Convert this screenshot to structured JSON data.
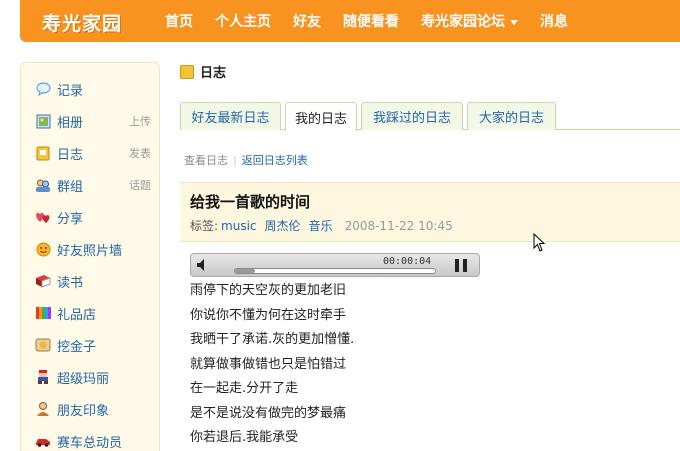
{
  "header": {
    "logo": "寿光家园",
    "nav": [
      {
        "label": "首页"
      },
      {
        "label": "个人主页"
      },
      {
        "label": "好友"
      },
      {
        "label": "随便看看"
      },
      {
        "label": "寿光家园论坛",
        "dropdown": true
      },
      {
        "label": "消息"
      }
    ]
  },
  "sidebar": {
    "items": [
      {
        "label": "记录",
        "sub": "",
        "icon": "speech-bubble-icon"
      },
      {
        "label": "相册",
        "sub": "上传",
        "icon": "photo-icon"
      },
      {
        "label": "日志",
        "sub": "发表",
        "icon": "notebook-icon"
      },
      {
        "label": "群组",
        "sub": "话题",
        "icon": "group-icon"
      },
      {
        "label": "分享",
        "sub": "",
        "icon": "hearts-icon"
      },
      {
        "label": "好友照片墙",
        "sub": "",
        "icon": "smiley-icon"
      },
      {
        "label": "读书",
        "sub": "",
        "icon": "book-icon"
      },
      {
        "label": "礼品店",
        "sub": "",
        "icon": "gift-icon"
      },
      {
        "label": "挖金子",
        "sub": "",
        "icon": "gold-icon"
      },
      {
        "label": "超级玛丽",
        "sub": "",
        "icon": "mario-icon"
      },
      {
        "label": "朋友印象",
        "sub": "",
        "icon": "person-icon"
      },
      {
        "label": "赛车总动员",
        "sub": "",
        "icon": "car-icon"
      }
    ]
  },
  "main": {
    "title": "日志",
    "tabs": [
      {
        "label": "好友最新日志",
        "active": false
      },
      {
        "label": "我的日志",
        "active": true
      },
      {
        "label": "我踩过的日志",
        "active": false
      },
      {
        "label": "大家的日志",
        "active": false
      }
    ],
    "breadcrumb": {
      "current": "查看日志",
      "link": "返回日志列表"
    },
    "post": {
      "title": "给我一首歌的时间",
      "tag_prefix": "标签:",
      "tags": [
        "music",
        "周杰伦",
        "音乐"
      ],
      "date": "2008-11-22 10:45"
    },
    "player": {
      "time": "00:00:04",
      "progress": 0.1
    },
    "lyrics": [
      "雨停下的天空灰的更加老旧",
      "你说你不懂为何在这时牵手",
      "我晒干了承诺.灰的更加憎懂.",
      "就算做事做错也只是怕错过",
      "在一起走.分开了走",
      "是不是说没有做完的梦最痛",
      "你若退后.我能承受"
    ]
  }
}
